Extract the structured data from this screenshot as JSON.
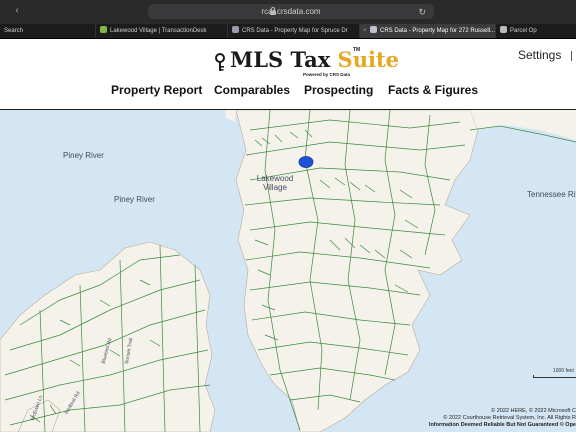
{
  "browser": {
    "url": "rcar.crsdata.com",
    "tabs": [
      {
        "label": "Search",
        "active": false
      },
      {
        "label": "Lakewood Village | TransactionDesk",
        "active": false
      },
      {
        "label": "CRS Data - Property Map for Spruce Dr",
        "active": false
      },
      {
        "label": "CRS Data - Property Map for 272 Russell...",
        "active": true
      },
      {
        "label": "Parcel Op",
        "active": false
      }
    ]
  },
  "header": {
    "logo_main": "MLS Tax ",
    "logo_accent": "Suite",
    "logo_tm": "TM",
    "logo_sub": "Powered by CRS Data",
    "settings_label": "Settings",
    "accent_color": "#e5a823"
  },
  "nav": {
    "items": [
      "Property Report",
      "Comparables",
      "Prospecting",
      "Facts & Figures"
    ]
  },
  "map": {
    "labels": {
      "piney_river_1": "Piney River",
      "piney_river_2": "Piney River",
      "lakewood_village": "Lakewood\nVillage",
      "tennessee_river": "Tennessee Riv",
      "road_1": "Sunset Trail",
      "road_2": "Bluebird Rd",
      "road_3": "McEwen Ln",
      "road_4": "Redbud Rd"
    },
    "scale_label": "1000 feet",
    "attribution": [
      "© 2022 HERE, © 2022 Microsoft C",
      "© 2022 Courthouse Retrieval System, Inc. All Rights R",
      "Information Deemed Reliable But Not Guaranteed © Ope"
    ],
    "water_color": "#d4e6f4",
    "parcel_color": "#3a8a3a",
    "marker_color": "#1e50d8"
  }
}
